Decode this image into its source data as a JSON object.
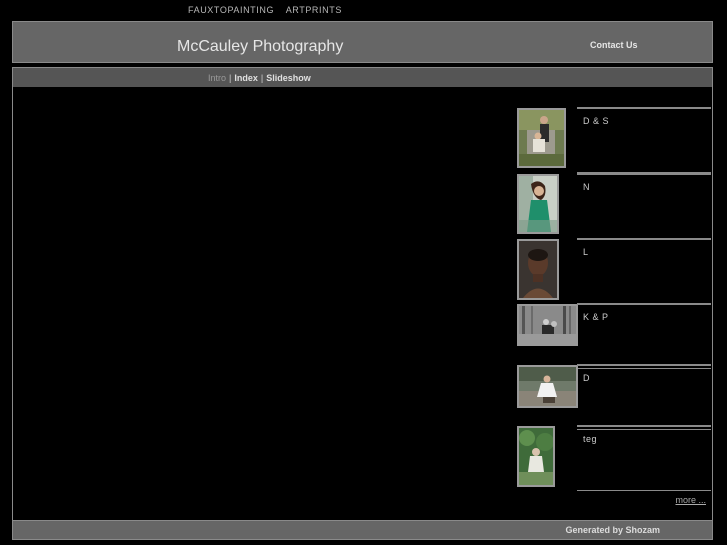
{
  "topnav": [
    "FAUXTOPAINTING",
    "ARTPRINTS"
  ],
  "header": {
    "title": "McCauley Photography",
    "contact": "Contact Us"
  },
  "tabs": {
    "intro": "Intro",
    "index": "Index",
    "slideshow": "Slideshow",
    "separator": "|"
  },
  "gallery": [
    {
      "caption": "D & S",
      "icon": "couple-portrait-photo"
    },
    {
      "caption": "N",
      "icon": "woman-green-dress-photo"
    },
    {
      "caption": "L",
      "icon": "portrait-photo"
    },
    {
      "caption": "K & P",
      "icon": "couple-bw-photo"
    },
    {
      "caption": "D",
      "icon": "woman-outdoor-photo"
    },
    {
      "caption": "teg",
      "icon": "greenery-photo"
    }
  ],
  "more": "more ...",
  "footer": "Generated by Shozam"
}
